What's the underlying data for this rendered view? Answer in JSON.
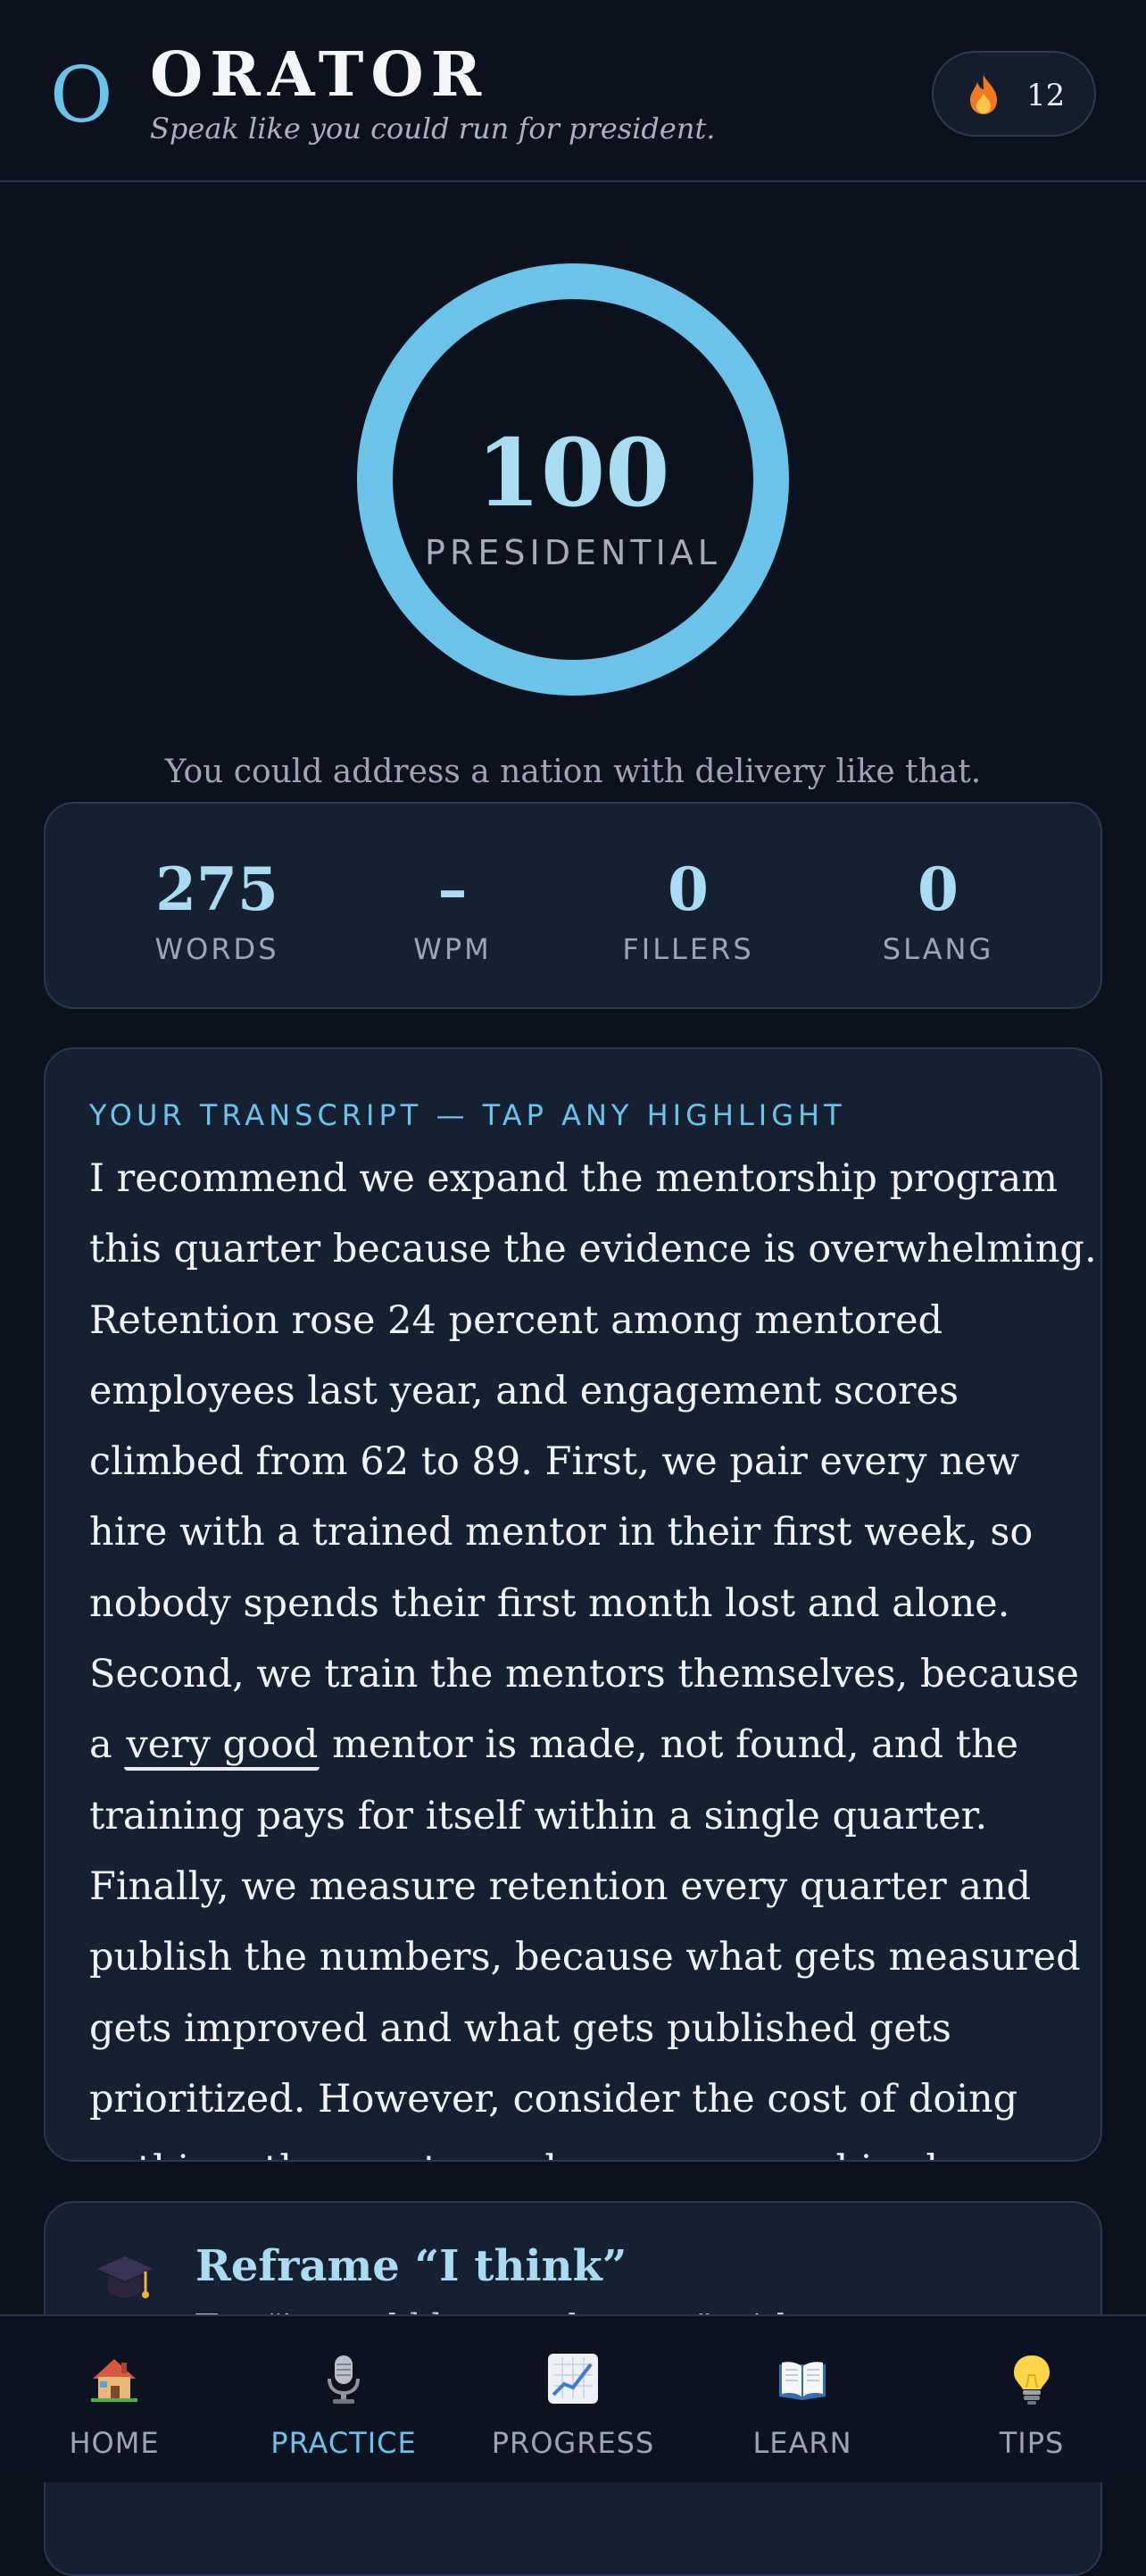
{
  "app": {
    "name": "ORATOR",
    "tagline": "Speak like you could run for president.",
    "streak_count": "12",
    "accent_color": "#6cc3ea",
    "background_color": "#0b121d"
  },
  "score": {
    "value": "100",
    "label": "PRESIDENTIAL",
    "praise": "You could address a nation with delivery like that."
  },
  "stats": [
    {
      "value": "275",
      "label": "WORDS"
    },
    {
      "value": "–",
      "label": "WPM"
    },
    {
      "value": "0",
      "label": "FILLERS"
    },
    {
      "value": "0",
      "label": "SLANG"
    }
  ],
  "transcript": {
    "heading": "YOUR TRANSCRIPT — TAP ANY HIGHLIGHT",
    "lines": [
      "I recommend we expand the mentorship program",
      "this quarter because the evidence is overwhelming.",
      "Retention rose 24 percent among mentored",
      "employees last year, and engagement scores",
      "climbed from 62 to 89. First, we pair every new",
      "hire with a trained mentor in their first week, so",
      "nobody spends their first month lost and alone.",
      "Second, we train the mentors themselves, because"
    ],
    "highlight_line": {
      "before": "a ",
      "highlight": "very good",
      "after": " mentor is made, not found, and the"
    },
    "lines_after": [
      "training pays for itself within a single quarter.",
      "Finally, we measure retention every quarter and",
      "publish the numbers, because what gets measured",
      "gets improved and what gets published gets",
      "prioritized. However, consider the cost of doing",
      "nothing: the mentors who were never hired"
    ]
  },
  "tip": {
    "icon": "graduation-cap-icon",
    "title": "Reframe “I think”",
    "subtitle": "Try “it would be my pleasure” with"
  },
  "nav": [
    {
      "label": "HOME",
      "icon": "house-icon",
      "active": false
    },
    {
      "label": "PRACTICE",
      "icon": "microphone-icon",
      "active": true
    },
    {
      "label": "PROGRESS",
      "icon": "chart-increasing-icon",
      "active": false
    },
    {
      "label": "LEARN",
      "icon": "open-book-icon",
      "active": false
    },
    {
      "label": "TIPS",
      "icon": "light-bulb-icon",
      "active": false
    }
  ]
}
